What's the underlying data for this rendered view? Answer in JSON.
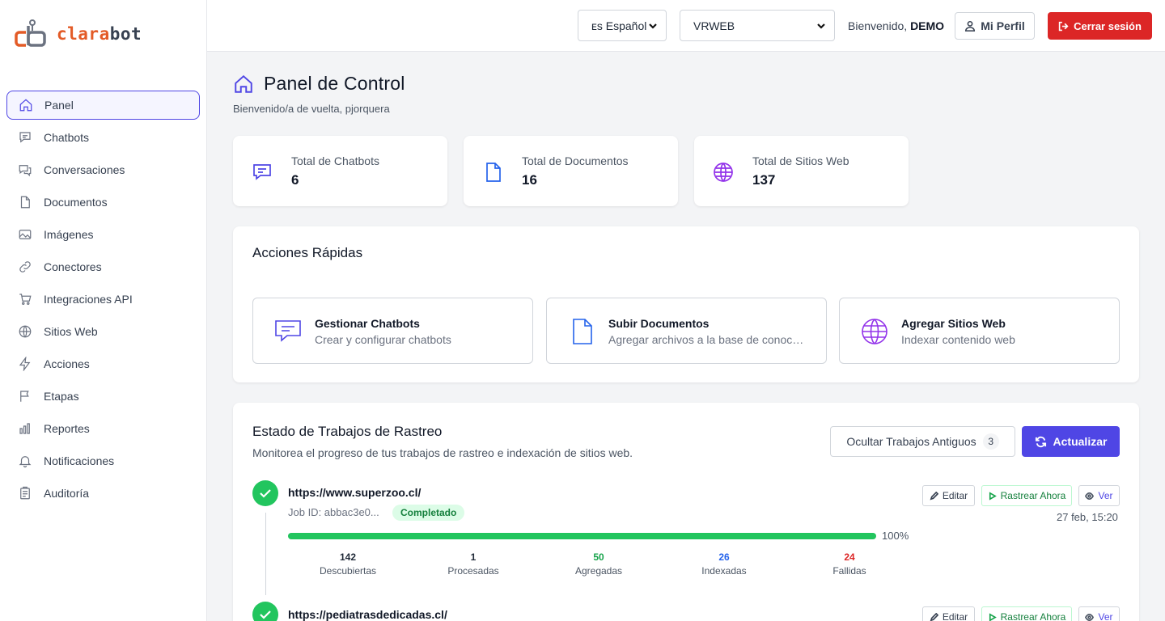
{
  "brand": {
    "part1": "clara",
    "part2": "bot"
  },
  "sidebar": {
    "items": [
      {
        "label": "Panel",
        "icon": "home-icon",
        "active": true
      },
      {
        "label": "Chatbots",
        "icon": "chat-icon"
      },
      {
        "label": "Conversaciones",
        "icon": "conversations-icon"
      },
      {
        "label": "Documentos",
        "icon": "document-icon"
      },
      {
        "label": "Imágenes",
        "icon": "image-icon"
      },
      {
        "label": "Conectores",
        "icon": "link-icon"
      },
      {
        "label": "Integraciones API",
        "icon": "cart-icon"
      },
      {
        "label": "Sitios Web",
        "icon": "globe-icon"
      },
      {
        "label": "Acciones",
        "icon": "bolt-icon"
      },
      {
        "label": "Etapas",
        "icon": "flag-icon"
      },
      {
        "label": "Reportes",
        "icon": "bar-chart-icon"
      },
      {
        "label": "Notificaciones",
        "icon": "bell-icon"
      },
      {
        "label": "Auditoría",
        "icon": "clipboard-icon"
      }
    ]
  },
  "topbar": {
    "language": "ᴇs Español",
    "workspace": "VRWEB",
    "welcome_prefix": "Bienvenido,",
    "welcome_user": "DEMO",
    "profile_label": "Mi Perfil",
    "logout_label": "Cerrar sesión"
  },
  "header": {
    "title": "Panel de Control",
    "subtitle": "Bienvenido/a de vuelta, pjorquera"
  },
  "stats": [
    {
      "label": "Total de Chatbots",
      "value": "6",
      "icon": "chat-icon",
      "color": "#4f46e5"
    },
    {
      "label": "Total de Documentos",
      "value": "16",
      "icon": "document-icon",
      "color": "#2563eb"
    },
    {
      "label": "Total de Sitios Web",
      "value": "137",
      "icon": "globe-icon",
      "color": "#9333ea"
    }
  ],
  "quick_actions": {
    "title": "Acciones Rápidas",
    "items": [
      {
        "title": "Gestionar Chatbots",
        "desc": "Crear y configurar chatbots",
        "icon": "chat-icon",
        "color": "#4f46e5"
      },
      {
        "title": "Subir Documentos",
        "desc": "Agregar archivos a la base de conocimiento",
        "icon": "document-icon",
        "color": "#2563eb"
      },
      {
        "title": "Agregar Sitios Web",
        "desc": "Indexar contenido web",
        "icon": "globe-icon",
        "color": "#9333ea"
      }
    ]
  },
  "crawl": {
    "title": "Estado de Trabajos de Rastreo",
    "subtitle": "Monitorea el progreso de tus trabajos de rastreo e indexación de sitios web.",
    "hide_label": "Ocultar Trabajos Antiguos",
    "hide_count": "3",
    "refresh_label": "Actualizar",
    "edit_label": "Editar",
    "crawl_now_label": "Rastrear Ahora",
    "view_label": "Ver",
    "jobs": [
      {
        "url": "https://www.superzoo.cl/",
        "job_id": "Job ID: abbac3e0...",
        "status": "Completado",
        "progress": 100,
        "progress_label": "100%",
        "date": "27 feb, 15:20",
        "metrics": [
          {
            "value": "142",
            "label": "Descubiertas",
            "color": "#111827"
          },
          {
            "value": "1",
            "label": "Procesadas",
            "color": "#111827"
          },
          {
            "value": "50",
            "label": "Agregadas",
            "color": "#16a34a"
          },
          {
            "value": "26",
            "label": "Indexadas",
            "color": "#2563eb"
          },
          {
            "value": "24",
            "label": "Fallidas",
            "color": "#dc2626"
          }
        ]
      },
      {
        "url": "https://pediatrasdedicadas.cl/"
      }
    ]
  }
}
